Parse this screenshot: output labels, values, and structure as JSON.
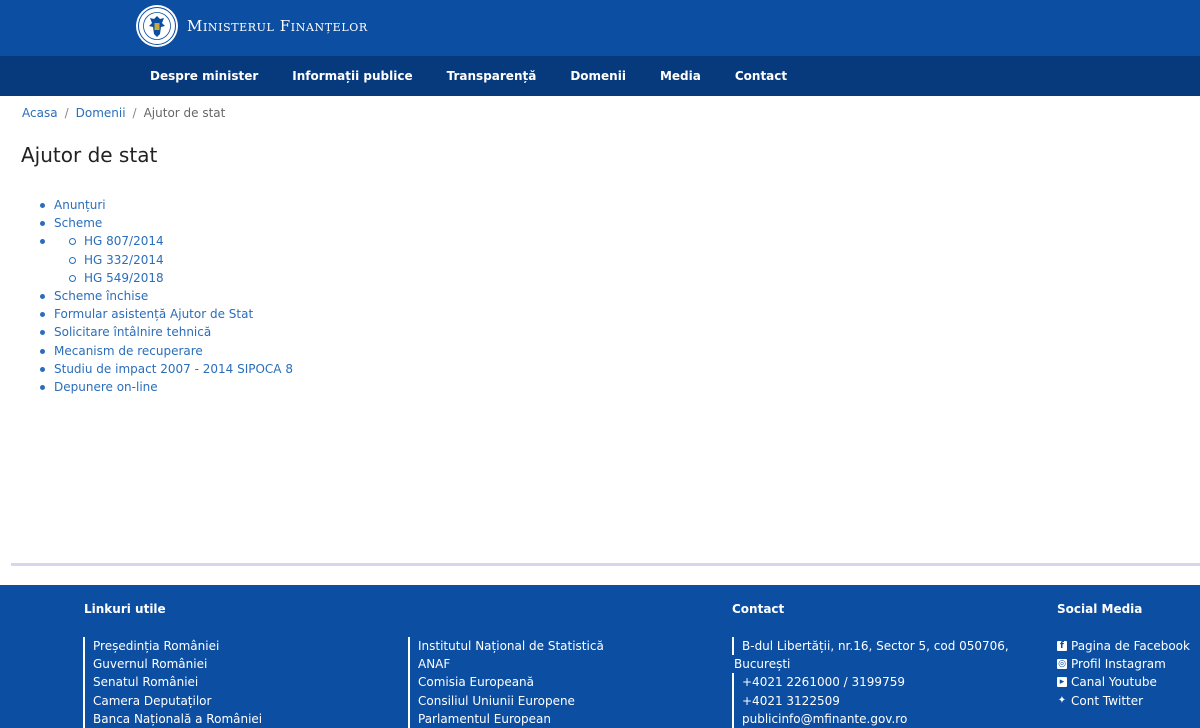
{
  "header": {
    "title": "Ministerul Finanțelor"
  },
  "nav": [
    "Despre minister",
    "Informații publice",
    "Transparență",
    "Domenii",
    "Media",
    "Contact"
  ],
  "breadcrumb": {
    "home": "Acasa",
    "section": "Domenii",
    "current": "Ajutor de stat"
  },
  "page": {
    "title": "Ajutor de stat"
  },
  "links": {
    "anunturi": "Anunțuri",
    "scheme": "Scheme",
    "scheme_sub": [
      "HG 807/2014",
      "HG 332/2014",
      "HG 549/2018"
    ],
    "rest": [
      "Scheme închise",
      "Formular asistență Ajutor de Stat",
      "Solicitare întâlnire tehnică",
      "Mecanism de recuperare",
      "Studiu de impact 2007 - 2014 SIPOCA 8",
      "Depunere on-line"
    ]
  },
  "footer": {
    "useful_title": "Linkuri utile",
    "useful_col1": [
      "Președinția României",
      "Guvernul României",
      "Senatul României",
      "Camera Deputaților",
      "Banca Națională a României"
    ],
    "useful_col2": [
      "Institutul Național de Statistică",
      "ANAF",
      "Comisia Europeană",
      "Consiliul Uniunii Europene",
      "Parlamentul European"
    ],
    "contact_title": "Contact",
    "contact": [
      "B-dul Libertății, nr.16, Sector 5, cod 050706,",
      "București",
      "+4021 2261000 / 3199759",
      "+4021 3122509",
      "publicinfo@mfinante.gov.ro"
    ],
    "social_title": "Social Media",
    "social": [
      {
        "icon": "facebook-icon",
        "label": "Pagina de Facebook"
      },
      {
        "icon": "instagram-icon",
        "label": "Profil Instagram"
      },
      {
        "icon": "youtube-icon",
        "label": "Canal Youtube"
      },
      {
        "icon": "twitter-icon",
        "label": "Cont Twitter"
      }
    ]
  }
}
